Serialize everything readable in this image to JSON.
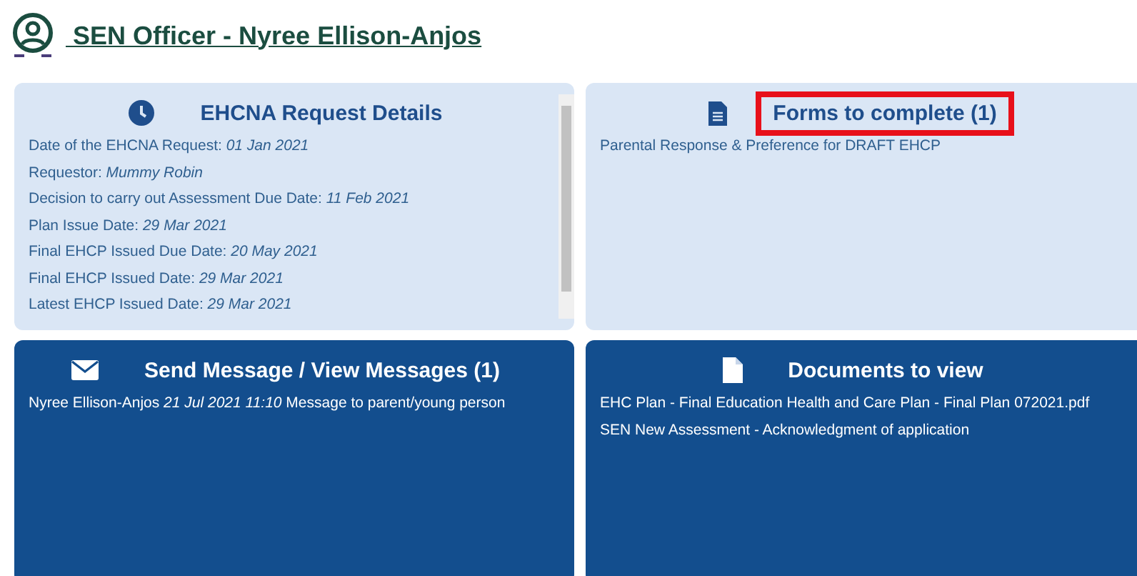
{
  "header": {
    "title": " SEN Officer - Nyree Ellison-Anjos"
  },
  "cards": [
    {
      "kind": "light",
      "title": "EHCNA Request Details",
      "scrollbar": true,
      "lines": [
        "Date of the EHCNA Request: *01 Jan 2021*",
        "Requestor: *Mummy Robin*",
        "Decision to carry out Assessment Due Date: *11 Feb 2021*",
        "Plan Issue Date: *29 Mar 2021*",
        "Final EHCP Issued Due Date: *20 May 2021*",
        "Final EHCP Issued Date: *29 Mar 2021*",
        "Latest EHCP Issued Date: *29 Mar 2021*"
      ]
    },
    {
      "kind": "light",
      "title": "Forms to complete (1)",
      "highlighted": true,
      "lines": [
        "Parental Response & Preference for DRAFT EHCP"
      ]
    },
    {
      "kind": "dark",
      "title": "Send Message / View Messages (1)",
      "lines": [
        "Nyree Ellison-Anjos *21 Jul 2021 11:10* Message to parent/young person"
      ]
    },
    {
      "kind": "dark",
      "title": "Documents to view",
      "lines": [
        "EHC Plan - Final Education Health and Care Plan - Final Plan 072021.pdf",
        "SEN New Assessment - Acknowledgment of application"
      ]
    }
  ]
}
